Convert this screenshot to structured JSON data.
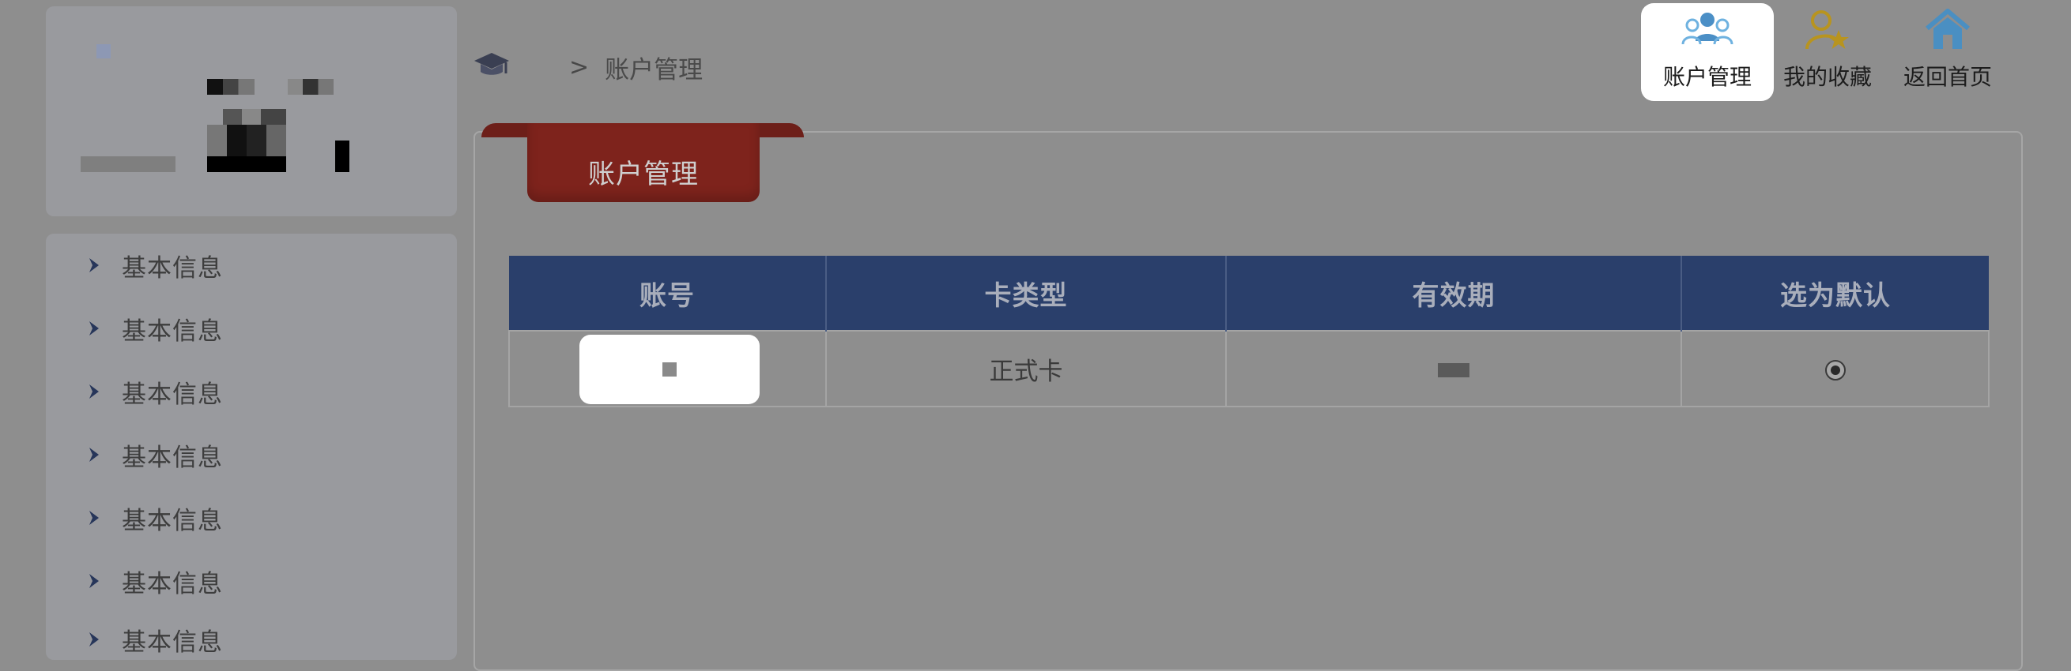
{
  "breadcrumb": {
    "separator": ">",
    "current": "账户管理"
  },
  "top_nav": {
    "items": [
      {
        "label": "账户管理",
        "icon": "users-icon",
        "active": true
      },
      {
        "label": "我的收藏",
        "icon": "user-star-icon",
        "active": false
      },
      {
        "label": "返回首页",
        "icon": "home-icon",
        "active": false
      }
    ]
  },
  "sidebar": {
    "items": [
      {
        "label": "基本信息"
      },
      {
        "label": "基本信息"
      },
      {
        "label": "基本信息"
      },
      {
        "label": "基本信息"
      },
      {
        "label": "基本信息"
      },
      {
        "label": "基本信息"
      },
      {
        "label": "基本信息"
      }
    ]
  },
  "panel": {
    "tab_title": "账户管理"
  },
  "table": {
    "headers": [
      "账号",
      "卡类型",
      "有效期",
      "选为默认"
    ],
    "rows": [
      {
        "account": "",
        "card_type": "正式卡",
        "expiry": "",
        "default_selected": true
      }
    ]
  },
  "colors": {
    "header_bg": "#2a3f6b",
    "ribbon": "#7e231c",
    "active_nav_bg": "#ffffff",
    "icon_blue": "#5a9fd0",
    "icon_gold": "#c9a227"
  }
}
